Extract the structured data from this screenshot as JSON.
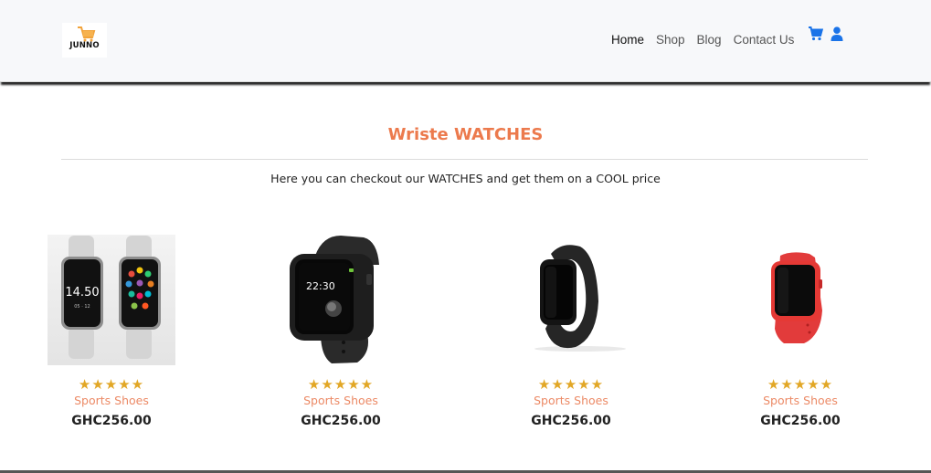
{
  "header": {
    "logo_text": "JUNNO",
    "nav": [
      {
        "label": "Home"
      },
      {
        "label": "Shop"
      },
      {
        "label": "Blog"
      },
      {
        "label": "Contact Us"
      }
    ],
    "icons": [
      "cart-icon",
      "user-icon"
    ],
    "accent_color": "#1a73e8"
  },
  "section": {
    "title": "Wriste WATCHES",
    "subtitle": "Here you can checkout our WATCHES and get them on a COOL price",
    "title_color": "#ec7a4d"
  },
  "products": [
    {
      "stars": "★★★★★",
      "category": "Sports Shoes",
      "price": "GHC256.00",
      "image": "two-white-smartwatches"
    },
    {
      "stars": "★★★★★",
      "category": "Sports Shoes",
      "price": "GHC256.00",
      "image": "black-smartwatch"
    },
    {
      "stars": "★★★★★",
      "category": "Sports Shoes",
      "price": "GHC256.00",
      "image": "black-fitness-band"
    },
    {
      "stars": "★★★★★",
      "category": "Sports Shoes",
      "price": "GHC256.00",
      "image": "red-smartwatch"
    }
  ]
}
